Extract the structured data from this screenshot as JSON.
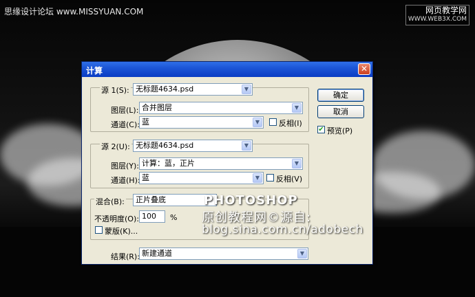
{
  "site": {
    "left_brand": "思缘设计论坛 www.MISSYUAN.COM",
    "right_brand": "网页教学网",
    "right_url": "WWW.WEB3X.COM"
  },
  "watermark": {
    "line1": "PHOTOSHOP",
    "line2": "原创教程网©源自:",
    "line3": "blog.sina.com.cn/adobech"
  },
  "dialog": {
    "title": "计算",
    "close_glyph": "✕",
    "source1": {
      "label": "源 1(S):",
      "file": "无标题4634.psd",
      "layer_label": "图层(L):",
      "layer_value": "合并图层",
      "channel_label": "通道(C):",
      "channel_value": "蓝",
      "invert_label": "反相(I)",
      "invert_checked": false
    },
    "source2": {
      "label": "源 2(U):",
      "file": "无标题4634.psd",
      "layer_label": "图层(Y):",
      "layer_value": "计算：蓝，正片",
      "channel_label": "通道(H):",
      "channel_value": "蓝",
      "invert_label": "反相(V)",
      "invert_checked": false
    },
    "blend": {
      "label": "混合(B):",
      "mode": "正片叠底",
      "opacity_label": "不透明度(O):",
      "opacity_value": "100",
      "opacity_unit": "%",
      "mask_label": "蒙版(K)...",
      "mask_checked": false
    },
    "result": {
      "label": "结果(R):",
      "value": "新建通道"
    },
    "buttons": {
      "ok": "确定",
      "cancel": "取消",
      "preview_label": "预览(P)",
      "preview_checked": true
    },
    "icons": {
      "dropdown": "chevron-down-icon",
      "check": "✔"
    }
  }
}
